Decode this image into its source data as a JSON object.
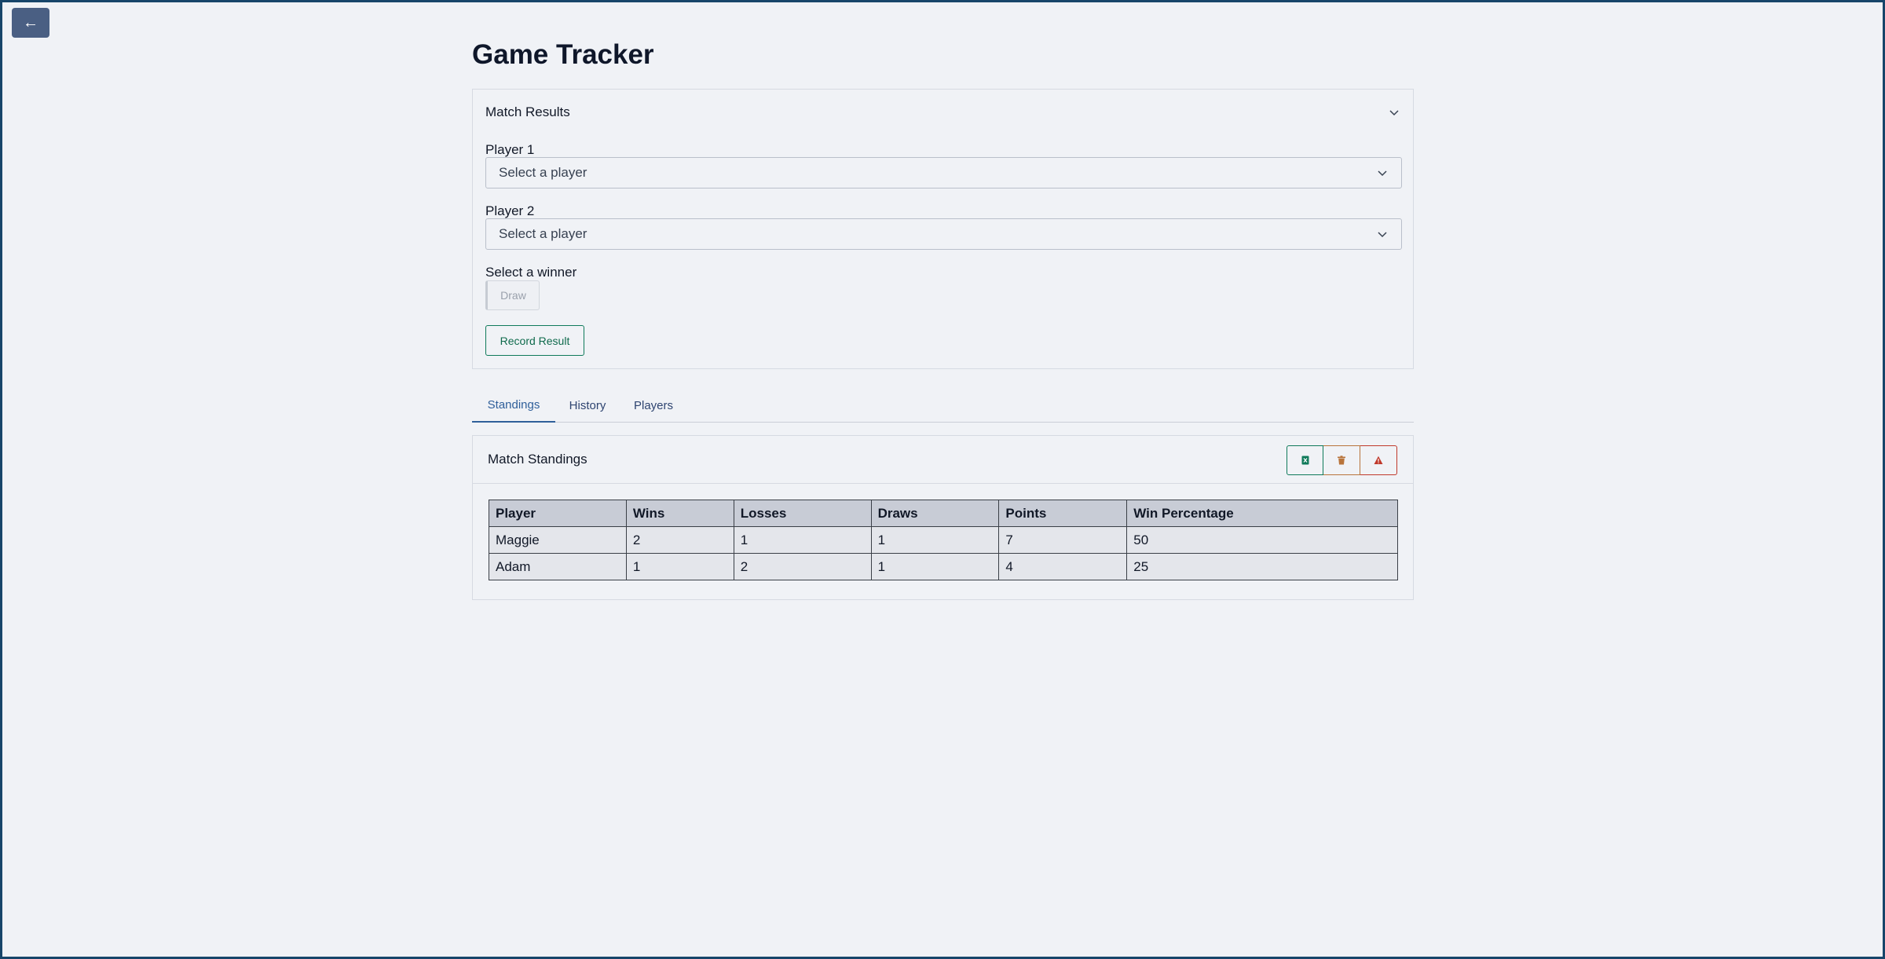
{
  "nav": {
    "back_label": "←"
  },
  "page": {
    "title": "Game Tracker"
  },
  "match_results": {
    "title": "Match Results",
    "player1": {
      "label": "Player 1",
      "placeholder": "Select a player"
    },
    "player2": {
      "label": "Player 2",
      "placeholder": "Select a player"
    },
    "winner": {
      "label": "Select a winner",
      "options": [
        "Draw"
      ]
    },
    "record_label": "Record Result"
  },
  "tabs": [
    {
      "label": "Standings",
      "active": true
    },
    {
      "label": "History",
      "active": false
    },
    {
      "label": "Players",
      "active": false
    }
  ],
  "standings": {
    "title": "Match Standings",
    "actions": [
      {
        "icon": "excel-icon",
        "color": "#0f7a5a"
      },
      {
        "icon": "trash-icon",
        "color": "#b8743b"
      },
      {
        "icon": "warning-icon",
        "color": "#c0392b"
      }
    ],
    "columns": [
      "Player",
      "Wins",
      "Losses",
      "Draws",
      "Points",
      "Win Percentage"
    ],
    "rows": [
      [
        "Maggie",
        "2",
        "1",
        "1",
        "7",
        "50"
      ],
      [
        "Adam",
        "1",
        "2",
        "1",
        "4",
        "25"
      ]
    ]
  },
  "colors": {
    "background": "#f0f2f6",
    "back_button": "#4a5f83",
    "accent_green": "#0f7a5a",
    "accent_blue": "#2f5f9a",
    "frame_border": "#17456a"
  }
}
